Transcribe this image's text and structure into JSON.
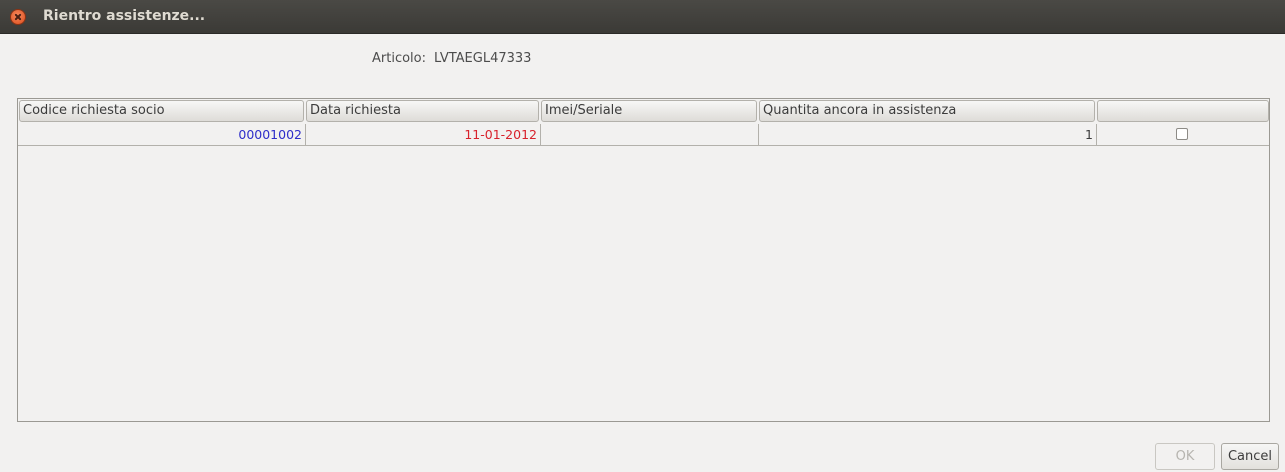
{
  "window": {
    "title": "Rientro assistenze..."
  },
  "article": {
    "label": "Articolo:",
    "code": "LVTAEGL47333"
  },
  "table": {
    "columns": [
      "Codice richiesta socio",
      "Data richiesta",
      "Imei/Seriale",
      "Quantita ancora in assistenza",
      ""
    ],
    "rows": [
      {
        "codice": "00001002",
        "data": "11-01-2012",
        "imei": "",
        "quantita": "1",
        "selected": false
      }
    ]
  },
  "colors": {
    "codice_text": "#2e2ec9",
    "data_text": "#d8222c"
  },
  "buttons": {
    "ok": "OK",
    "cancel": "Cancel"
  }
}
